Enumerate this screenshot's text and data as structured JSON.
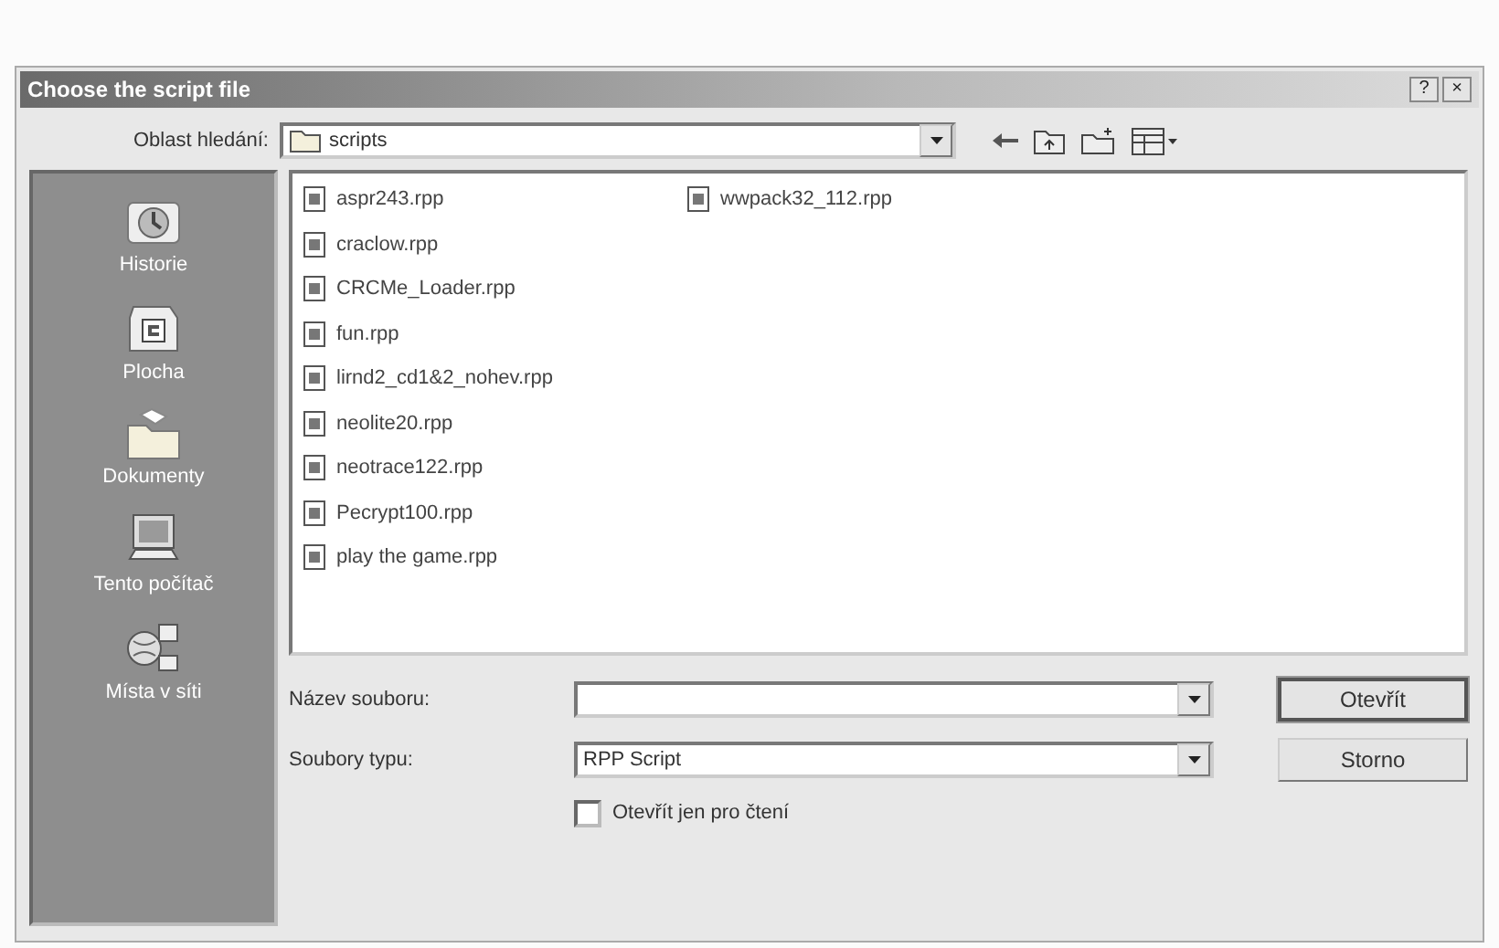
{
  "window": {
    "title": "Choose the script file",
    "buttons": [
      "?",
      "×"
    ]
  },
  "look_in": {
    "label": "Oblast hledání:",
    "value": "scripts"
  },
  "places": [
    {
      "label": "Historie",
      "kind": "history"
    },
    {
      "label": "Plocha",
      "kind": "desktop"
    },
    {
      "label": "Dokumenty",
      "kind": "documents"
    },
    {
      "label": "Tento počítač",
      "kind": "computer"
    },
    {
      "label": "Místa v síti",
      "kind": "network"
    }
  ],
  "files": [
    {
      "name": "aspr243.rpp"
    },
    {
      "name": "craclow.rpp"
    },
    {
      "name": "CRCMe_Loader.rpp"
    },
    {
      "name": "fun.rpp"
    },
    {
      "name": "lirnd2_cd1&2_nohev.rpp"
    },
    {
      "name": "neolite20.rpp"
    },
    {
      "name": "neotrace122.rpp"
    },
    {
      "name": "Pecrypt100.rpp"
    },
    {
      "name": "play the game.rpp"
    },
    {
      "name": "wwpack32_112.rpp"
    }
  ],
  "file_name": {
    "label": "Název souboru:"
  },
  "file_type": {
    "label": "Soubory typu:",
    "value": "RPP Script"
  },
  "read_only": {
    "label": "Otevřít jen pro čtení",
    "checked": false
  },
  "buttons": [
    {
      "label": "Otevřít",
      "default": true
    },
    {
      "label": "Storno",
      "default": false
    }
  ]
}
